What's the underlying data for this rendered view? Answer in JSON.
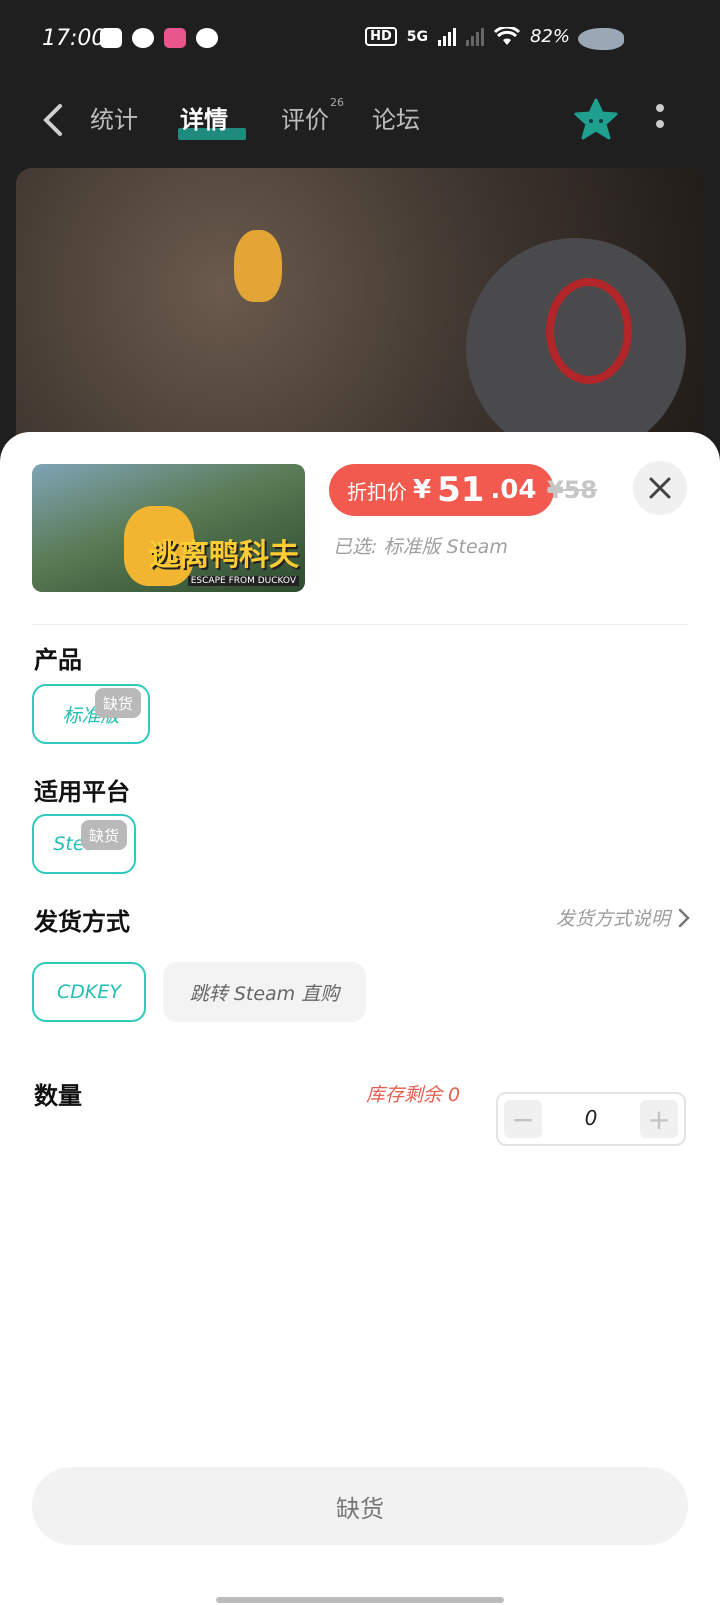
{
  "status_bar": {
    "time": "17:00",
    "hd": "HD",
    "network": "5G",
    "battery": "82%"
  },
  "nav": {
    "tabs": [
      "统计",
      "详情",
      "评价",
      "论坛"
    ],
    "active_tab": "详情",
    "review_badge": "26",
    "accent_color": "#1f8a7e"
  },
  "product": {
    "thumbnail_title": "逃离鸭科夫",
    "thumbnail_subtitle": "ESCAPE FROM DUCKOV",
    "price_label": "折扣价",
    "price_currency": "¥",
    "price_integer": "51",
    "price_decimal": ".04",
    "original_price": "¥58",
    "selected": "已选: 标准版 Steam"
  },
  "sections": {
    "product_label": "产品",
    "product_option": "标准版",
    "platform_label": "适用平台",
    "platform_option": "Steam",
    "out_of_stock_tag": "缺货",
    "delivery_label": "发货方式",
    "delivery_help": "发货方式说明",
    "delivery_option_1": "CDKEY",
    "delivery_option_2": "跳转 Steam 直购",
    "quantity_label": "数量",
    "stock_text": "库存剩余 0",
    "quantity_value": "0",
    "minus": "−",
    "plus": "+"
  },
  "bottom_button": "缺货",
  "colors": {
    "price_red": "#f25a50",
    "teal": "#2fc9bd",
    "stock_red": "#e4604f"
  }
}
